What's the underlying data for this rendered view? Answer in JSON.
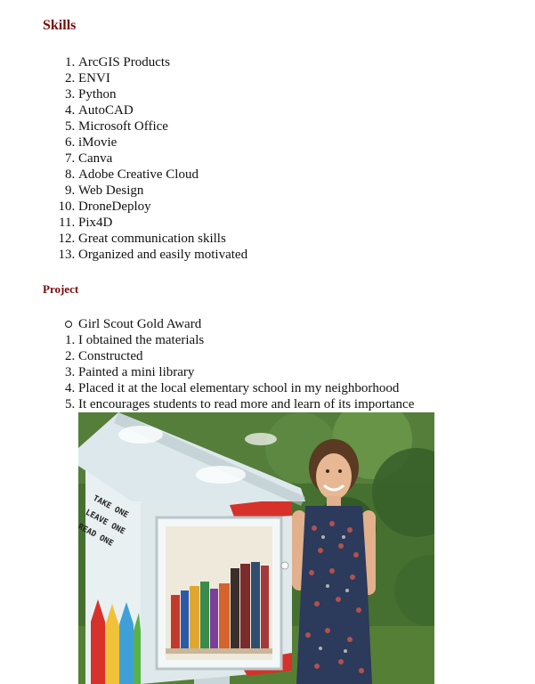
{
  "skills": {
    "heading": "Skills",
    "items": [
      "ArcGIS Products",
      "ENVI",
      "Python",
      "AutoCAD",
      "Microsoft Office",
      "iMovie",
      "Canva",
      "Adobe Creative Cloud",
      "Web Design",
      "DroneDeploy",
      "Pix4D",
      "Great communication skills",
      "Organized and easily motivated"
    ]
  },
  "project": {
    "heading": "Project",
    "bullet": "Girl Scout Gold Award",
    "steps": [
      "I obtained the materials",
      "Constructed",
      "Painted a mini library",
      "Placed it at the local elementary school in my neighborhood",
      "It encourages students to read more and learn of its importance"
    ],
    "photo": {
      "sign_lines": [
        "TAKE ONE",
        "LEAVE ONE",
        "READ ONE"
      ]
    }
  },
  "colors": {
    "heading": "#7a0a0a",
    "text": "#111111",
    "foliage": "#3f6b2c",
    "box": "#e6eef0",
    "roof": "#dfe8ec"
  }
}
